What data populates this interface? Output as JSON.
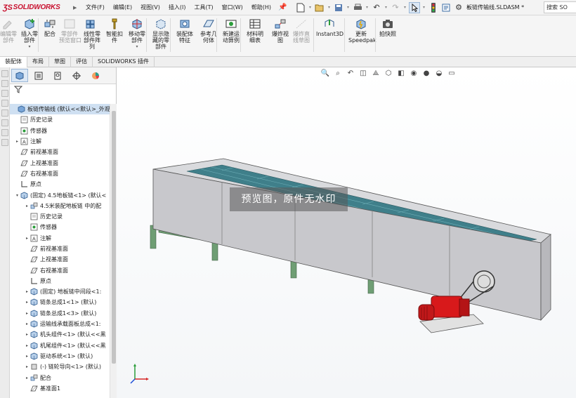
{
  "app": {
    "brand": "SOLIDWORKS",
    "doc_title": "板链传输线.SLDASM *",
    "search_text": "搜索 SO"
  },
  "menu": [
    "文件(F)",
    "编辑(E)",
    "视图(V)",
    "插入(I)",
    "工具(T)",
    "窗口(W)",
    "帮助(H)"
  ],
  "ribbon": {
    "buttons": [
      {
        "label": "编辑零\n部件",
        "icon": "edit-component-icon",
        "enabled": false
      },
      {
        "label": "插入零\n部件",
        "icon": "insert-components-icon",
        "enabled": true
      },
      {
        "label": "配合",
        "icon": "mate-icon",
        "enabled": true
      },
      {
        "label": "零部件\n预览窗口",
        "icon": "component-preview-icon",
        "enabled": false
      },
      {
        "label": "线性零\n部件阵\n列",
        "icon": "linear-pattern-icon",
        "enabled": true
      },
      {
        "label": "智能扣\n件",
        "icon": "smart-fasteners-icon",
        "enabled": true
      },
      {
        "label": "移动零\n部件",
        "icon": "move-component-icon",
        "enabled": true
      },
      {
        "label": "显示隐\n藏的零\n部件",
        "icon": "show-hidden-icon",
        "enabled": true
      },
      {
        "label": "装配体\n特征",
        "icon": "assembly-features-icon",
        "enabled": true
      },
      {
        "label": "参考几\n何体",
        "icon": "reference-geometry-icon",
        "enabled": true
      },
      {
        "label": "新建运\n动算例",
        "icon": "motion-study-icon",
        "enabled": true
      },
      {
        "label": "材料明\n细表",
        "icon": "bom-icon",
        "enabled": true
      },
      {
        "label": "爆炸视\n图",
        "icon": "exploded-view-icon",
        "enabled": true
      },
      {
        "label": "爆炸直\n线草图",
        "icon": "explode-line-sketch-icon",
        "enabled": false
      },
      {
        "label": "Instant3D",
        "icon": "instant3d-icon",
        "enabled": true
      },
      {
        "label": "更新\nSpeedpak",
        "icon": "speedpak-icon",
        "enabled": true
      },
      {
        "label": "拍快照",
        "icon": "snapshot-icon",
        "enabled": true
      }
    ]
  },
  "tabs": [
    {
      "label": "装配体",
      "active": true
    },
    {
      "label": "布局",
      "active": false
    },
    {
      "label": "草图",
      "active": false
    },
    {
      "label": "评估",
      "active": false
    },
    {
      "label": "SOLIDWORKS 插件",
      "active": false
    }
  ],
  "tree": [
    {
      "label": "板链传输线 (默认<<默认>_外观",
      "icon": "assembly",
      "level": 0,
      "expander": "",
      "selected": true
    },
    {
      "label": "历史记录",
      "icon": "history",
      "level": 1,
      "expander": ""
    },
    {
      "label": "传感器",
      "icon": "sensor",
      "level": 1,
      "expander": ""
    },
    {
      "label": "注解",
      "icon": "annotation",
      "level": 1,
      "expander": "▸"
    },
    {
      "label": "前视基准面",
      "icon": "plane",
      "level": 1,
      "expander": ""
    },
    {
      "label": "上视基准面",
      "icon": "plane",
      "level": 1,
      "expander": ""
    },
    {
      "label": "右视基准面",
      "icon": "plane",
      "level": 1,
      "expander": ""
    },
    {
      "label": "原点",
      "icon": "origin",
      "level": 1,
      "expander": ""
    },
    {
      "label": "(固定) 4.5地板链<1> (默认<",
      "icon": "subassembly",
      "level": 1,
      "expander": "▾"
    },
    {
      "label": "4.5米装配地板链 中的配",
      "icon": "mates",
      "level": 2,
      "expander": "▸"
    },
    {
      "label": "历史记录",
      "icon": "history",
      "level": 2,
      "expander": ""
    },
    {
      "label": "传感器",
      "icon": "sensor",
      "level": 2,
      "expander": ""
    },
    {
      "label": "注解",
      "icon": "annotation",
      "level": 2,
      "expander": "▸"
    },
    {
      "label": "前视基准面",
      "icon": "plane",
      "level": 2,
      "expander": ""
    },
    {
      "label": "上视基准面",
      "icon": "plane",
      "level": 2,
      "expander": ""
    },
    {
      "label": "右视基准面",
      "icon": "plane",
      "level": 2,
      "expander": ""
    },
    {
      "label": "原点",
      "icon": "origin",
      "level": 2,
      "expander": ""
    },
    {
      "label": "(固定) 地板链中间段<1:",
      "icon": "subassembly",
      "level": 2,
      "expander": "▸"
    },
    {
      "label": "链条总成1<1> (默认)",
      "icon": "subassembly",
      "level": 2,
      "expander": "▸"
    },
    {
      "label": "链条总成1<3> (默认)",
      "icon": "subassembly",
      "level": 2,
      "expander": "▸"
    },
    {
      "label": "运输线承载面板总成<1:",
      "icon": "subassembly",
      "level": 2,
      "expander": "▸"
    },
    {
      "label": "机头组件<1> (默认<<黑",
      "icon": "subassembly",
      "level": 2,
      "expander": "▸"
    },
    {
      "label": "机尾组件<1> (默认<<黑",
      "icon": "subassembly",
      "level": 2,
      "expander": "▸"
    },
    {
      "label": "驱动系统<1> (默认)",
      "icon": "subassembly",
      "level": 2,
      "expander": "▸"
    },
    {
      "label": "(-) 链轮导向<1> (默认)",
      "icon": "part",
      "level": 2,
      "expander": "▸"
    },
    {
      "label": "配合",
      "icon": "mates",
      "level": 2,
      "expander": "▸"
    },
    {
      "label": "基准面1",
      "icon": "plane",
      "level": 2,
      "expander": ""
    }
  ],
  "watermark": "预览图，原件无水印",
  "colors": {
    "accent": "#3b6ea5",
    "brand": "#c8102e",
    "conveyor_body": "#c8c8cc",
    "slats": "#3f7f8a",
    "legs": "#6f9e74",
    "motor": "#d8191b"
  }
}
